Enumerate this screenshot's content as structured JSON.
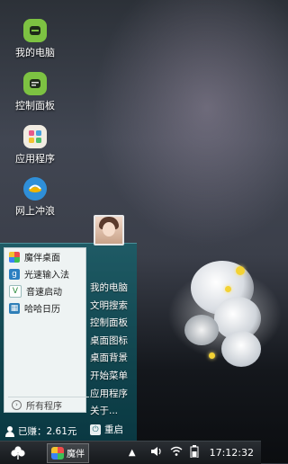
{
  "desktop_icons": [
    {
      "label": "我的电脑",
      "icon": "computer-icon"
    },
    {
      "label": "控制面板",
      "icon": "control-panel-icon"
    },
    {
      "label": "应用程序",
      "icon": "apps-icon"
    },
    {
      "label": "网上冲浪",
      "icon": "browser-icon"
    }
  ],
  "start_menu": {
    "programs": [
      {
        "label": "魔伴桌面",
        "icon": "mobanzhuomian-icon"
      },
      {
        "label": "光速输入法",
        "icon": "input-method-icon"
      },
      {
        "label": "音速启动",
        "icon": "launcher-icon"
      },
      {
        "label": "哈哈日历",
        "icon": "calendar-icon"
      }
    ],
    "all_programs": "所有程序",
    "quick_links": [
      "我的电脑",
      "文明搜索",
      "控制面板",
      "桌面图标",
      "桌面背景",
      "开始菜单",
      "应用程序",
      "关于..."
    ],
    "earned": "已赚：2.61元",
    "restart": "重启"
  },
  "taskbar": {
    "app_label": "魔伴",
    "clock": "17:12:32"
  },
  "colors": {
    "start_menu_bg": "#195f69",
    "taskbar_bg": "#1e2226"
  }
}
